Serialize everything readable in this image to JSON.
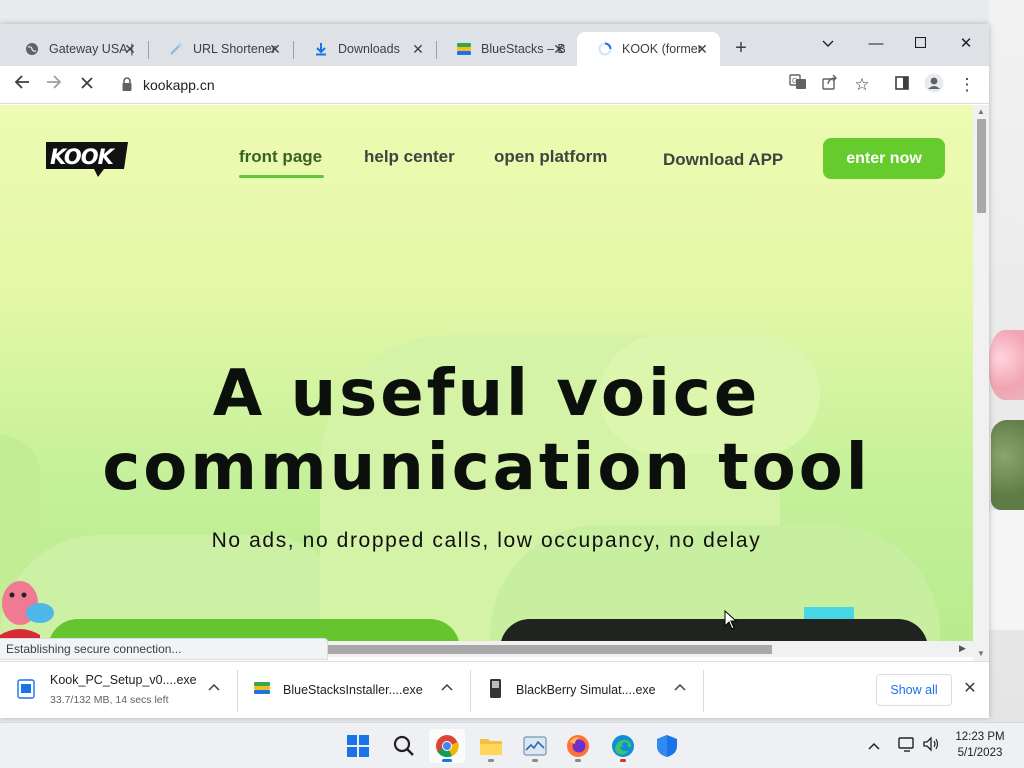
{
  "browser": {
    "tabs": [
      {
        "title": "Gateway USA |",
        "icon": "globe-icon",
        "active": false
      },
      {
        "title": "URL Shortener",
        "icon": "link-icon",
        "active": false
      },
      {
        "title": "Downloads",
        "icon": "download-icon",
        "active": false
      },
      {
        "title": "BlueStacks – B",
        "icon": "bluestacks-icon",
        "active": false
      },
      {
        "title": "KOOK (former",
        "icon": "loading-spinner-icon",
        "active": true
      }
    ],
    "url": "kookapp.cn",
    "status_text": "Establishing secure connection..."
  },
  "page": {
    "nav": {
      "front_page": "front page",
      "help_center": "help center",
      "open_platform": "open platform",
      "download_app": "Download APP",
      "enter_now": "enter now"
    },
    "hero_line1": "A useful voice",
    "hero_line2": "communication tool",
    "subline": "No ads, no dropped calls, low occupancy, no delay",
    "colors": {
      "accent": "#66cc2d",
      "dark_button": "#1f2421",
      "background_top": "#eefbb2"
    }
  },
  "downloads": {
    "items": [
      {
        "name": "Kook_PC_Setup_v0....exe",
        "detail": "33.7/132 MB, 14 secs left",
        "icon": "installer-icon"
      },
      {
        "name": "BlueStacksInstaller....exe",
        "detail": "",
        "icon": "bluestacks-icon"
      },
      {
        "name": "BlackBerry Simulat....exe",
        "detail": "",
        "icon": "phone-icon"
      }
    ],
    "show_all": "Show all"
  },
  "taskbar": {
    "time": "12:23 PM",
    "date": "5/1/2023"
  }
}
